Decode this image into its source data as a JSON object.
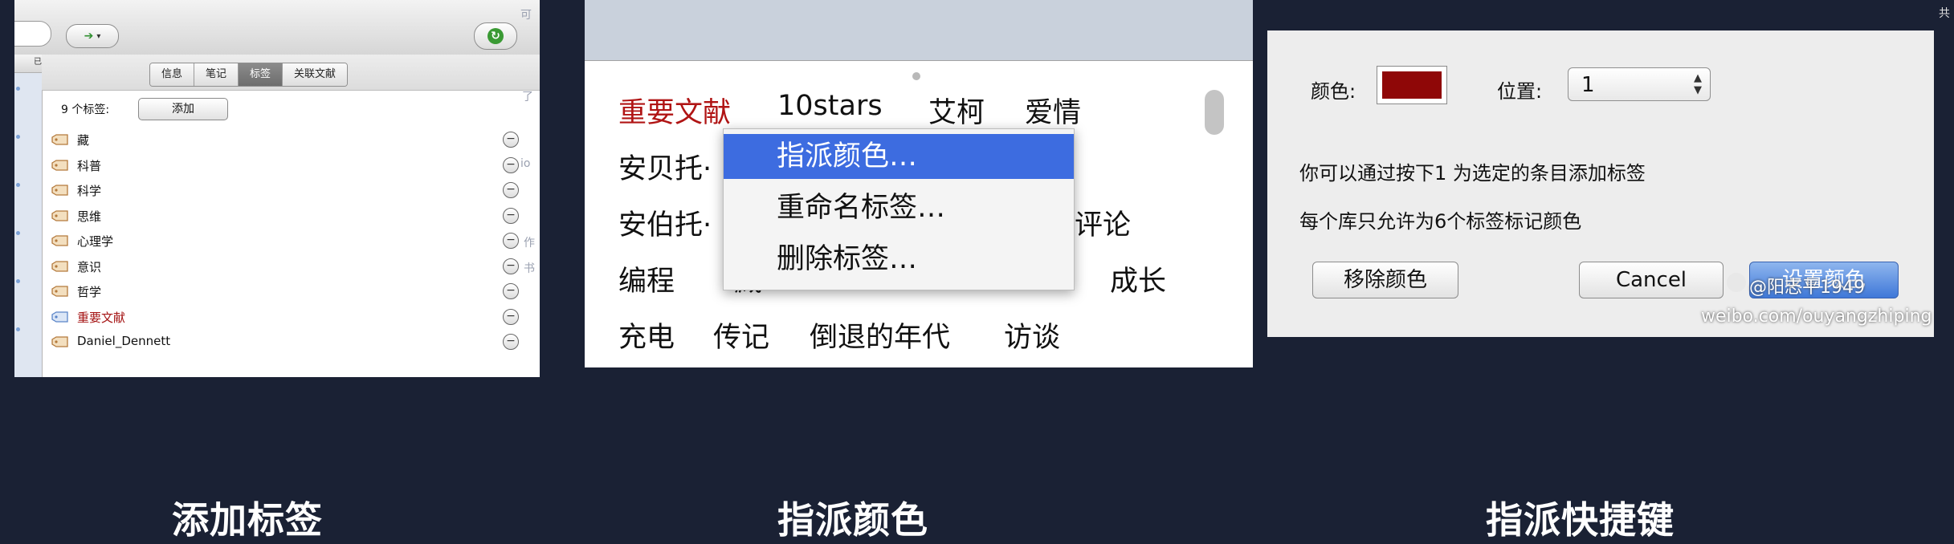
{
  "panel1": {
    "tabs": [
      {
        "label": "信息"
      },
      {
        "label": "笔记"
      },
      {
        "label": "标签",
        "active": true
      },
      {
        "label": "关联文献"
      }
    ],
    "tag_count": "9 个标签:",
    "add_button": "添加",
    "tags": [
      {
        "label": "藏",
        "color": ""
      },
      {
        "label": "科普",
        "color": ""
      },
      {
        "label": "科学",
        "color": ""
      },
      {
        "label": "思维",
        "color": ""
      },
      {
        "label": "心理学",
        "color": ""
      },
      {
        "label": "意识",
        "color": ""
      },
      {
        "label": "哲学",
        "color": ""
      },
      {
        "label": "重要文献",
        "color": "#a51414"
      },
      {
        "label": "Daniel_Dennett",
        "color": ""
      }
    ],
    "sidebar_header": "已",
    "icons": {
      "nav": "forward-arrow-icon",
      "sync": "sync-icon",
      "tag": "tag-icon",
      "remove": "minus-circle-icon"
    }
  },
  "fragments": {
    "f1": "可",
    "f2": "了",
    "f3": "io",
    "f4": "书",
    "f5": "作",
    "f6": "共"
  },
  "panel2": {
    "cloud": [
      {
        "text": "重要文献",
        "red": true
      },
      {
        "text": "10stars"
      },
      {
        "text": "艾柯"
      },
      {
        "text": "爱情"
      },
      {
        "text": "安贝托·"
      },
      {
        "text": "安伯托·"
      },
      {
        "text": "巴黎评论"
      },
      {
        "text": "编程"
      },
      {
        "text": "藏"
      },
      {
        "text": "成长"
      },
      {
        "text": "充电"
      },
      {
        "text": "传记"
      },
      {
        "text": "倒退的年代"
      },
      {
        "text": "访谈"
      }
    ],
    "context_menu": [
      {
        "label": "指派颜色…",
        "highlighted": true
      },
      {
        "label": "重命名标签…"
      },
      {
        "label": "删除标签…"
      }
    ]
  },
  "panel3": {
    "color_label": "颜色:",
    "color_value": "#8f0707",
    "position_label": "位置:",
    "position_value": "1",
    "line1": "你可以通过按下1 为选定的条目添加标签",
    "line2": "每个库只允许为6个标签标记颜色",
    "remove_color_button": "移除颜色",
    "cancel_button": "Cancel",
    "assign_button": "设置颜色"
  },
  "watermark": {
    "handle": "@阳志平1949",
    "url": "weibo.com/ouyangzhiping"
  },
  "captions": [
    "添加标签",
    "指派颜色",
    "指派快捷键"
  ]
}
